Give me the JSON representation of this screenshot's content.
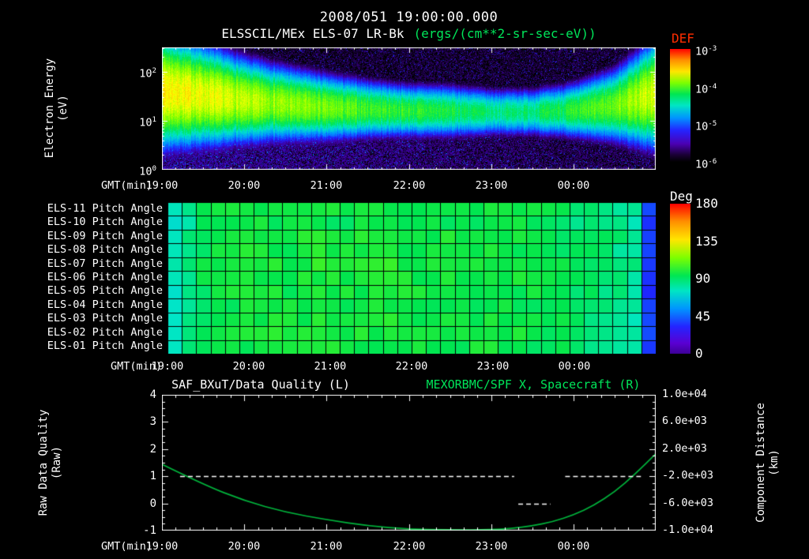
{
  "header": {
    "timestamp": "2008/051 19:00:00.000",
    "instrument": "ELSSCIL/MEx ELS-07 LR-Bk",
    "units": "(ergs/(cm**2-sr-sec-eV))"
  },
  "colors": {
    "background": "#000000",
    "text": "#ffffff",
    "accent_green": "#00e65a",
    "curve_green": "#00b43c",
    "def_red": "#ff2d00"
  },
  "time_axis": {
    "label": "GMT(min)",
    "ticks": [
      "19:00",
      "20:00",
      "21:00",
      "22:00",
      "23:00",
      "00:00"
    ]
  },
  "spectrogram": {
    "ylabel_line1": "Electron Energy",
    "ylabel_line2": "(eV)",
    "yticks": [
      {
        "base": "10",
        "exp": "2"
      },
      {
        "base": "10",
        "exp": "1"
      },
      {
        "base": "10",
        "exp": "0"
      }
    ],
    "colorbar": {
      "label": "DEF",
      "ticks": [
        {
          "base": "10",
          "exp": "-3"
        },
        {
          "base": "10",
          "exp": "-4"
        },
        {
          "base": "10",
          "exp": "-5"
        },
        {
          "base": "10",
          "exp": "-6"
        }
      ]
    }
  },
  "pitch": {
    "row_labels": [
      "ELS-11 Pitch Angle",
      "ELS-10 Pitch Angle",
      "ELS-09 Pitch Angle",
      "ELS-08 Pitch Angle",
      "ELS-07 Pitch Angle",
      "ELS-06 Pitch Angle",
      "ELS-05 Pitch Angle",
      "ELS-04 Pitch Angle",
      "ELS-03 Pitch Angle",
      "ELS-02 Pitch Angle",
      "ELS-01 Pitch Angle"
    ],
    "colorbar": {
      "label": "Deg",
      "ticks": [
        "180",
        "135",
        "90",
        "45",
        "0"
      ]
    }
  },
  "bottom": {
    "title_left": "SAF_BXuT/Data Quality (L)",
    "title_right": "MEXORBMC/SPF X, Spacecraft (R)",
    "ylabel_left_line1": "Raw Data Quality",
    "ylabel_left_line2": "(Raw)",
    "ylabel_right_line1": "Component Distance",
    "ylabel_right_line2": "(km)",
    "left_ticks": [
      "4",
      "3",
      "2",
      "1",
      "0",
      "-1"
    ],
    "right_ticks": [
      "1.0e+04",
      "6.0e+03",
      "2.0e+03",
      "-2.0e+03",
      "-6.0e+03",
      "-1.0e+04"
    ]
  },
  "chart_data": [
    {
      "type": "heatmap",
      "name": "electron-energy-spectrogram",
      "title": "ELSSCIL/MEx ELS-07 LR-Bk",
      "units": "ergs/(cm**2-sr-sec-eV)",
      "x_range_hours": [
        19,
        25
      ],
      "x_tick_labels": [
        "19:00",
        "20:00",
        "21:00",
        "22:00",
        "23:00",
        "00:00"
      ],
      "y_log10_eV_range": [
        0,
        2.5
      ],
      "def_log10_range": [
        -6,
        -3
      ],
      "band_hours": [
        19,
        19.5,
        20,
        20.5,
        21,
        21.5,
        22,
        22.5,
        23,
        23.5,
        24,
        24.5,
        25
      ],
      "band_center_log10_eV": [
        1.6,
        1.52,
        1.42,
        1.35,
        1.28,
        1.24,
        1.21,
        1.2,
        1.18,
        1.18,
        1.22,
        1.32,
        1.55
      ],
      "band_halfwidth_log10": [
        0.45,
        0.4,
        0.34,
        0.3,
        0.27,
        0.24,
        0.22,
        0.22,
        0.2,
        0.2,
        0.23,
        0.3,
        0.44
      ],
      "band_peak_def": [
        0.00025,
        0.0002,
        0.00015,
        0.00012,
        0.0001,
        8e-05,
        7e-05,
        6e-05,
        4.5e-05,
        5e-05,
        6.5e-05,
        0.0001,
        0.00018
      ],
      "background_def": 1e-06,
      "seed": 7
    },
    {
      "type": "heatmap",
      "name": "pitch-angle-panel",
      "rows": [
        "ELS-11",
        "ELS-10",
        "ELS-09",
        "ELS-08",
        "ELS-07",
        "ELS-06",
        "ELS-05",
        "ELS-04",
        "ELS-03",
        "ELS-02",
        "ELS-01"
      ],
      "deg_range": [
        0,
        180
      ],
      "n_time_cols": 34,
      "column_mean_deg": [
        78,
        85,
        93,
        96,
        95,
        96,
        97,
        96,
        95,
        96,
        97,
        96,
        95,
        96,
        96,
        97,
        96,
        95,
        96,
        96,
        95,
        96,
        97,
        96,
        95,
        94,
        93,
        92,
        90,
        89,
        88,
        86,
        82,
        36
      ],
      "row_offset_deg": [
        0,
        -2,
        1,
        0,
        2,
        1,
        0,
        -1,
        0,
        1,
        0
      ],
      "cell_noise_deg": 4,
      "seed": 11
    },
    {
      "type": "line",
      "name": "quality-and-spacecraft-x",
      "x_range_hours": [
        19,
        25
      ],
      "left_axis": {
        "label": "Raw Data Quality (Raw)",
        "range": [
          -1,
          4
        ]
      },
      "right_axis": {
        "label": "Component Distance (km)",
        "range": [
          -10000,
          10000
        ]
      },
      "series": [
        {
          "name": "SAF_BXuT/Data Quality",
          "axis": "left",
          "style": "dashed",
          "color": "#ffffff",
          "segments": [
            {
              "value": 1,
              "from_hour": 19.22,
              "to_hour": 23.28
            },
            {
              "value": 0,
              "from_hour": 23.33,
              "to_hour": 23.72
            },
            {
              "value": 1,
              "from_hour": 23.9,
              "to_hour": 24.82
            }
          ]
        },
        {
          "name": "MEXORBMC/SPF X, Spacecraft",
          "axis": "right",
          "style": "solid",
          "color": "#00b43c",
          "points_hour_km": [
            [
              19.0,
              -230
            ],
            [
              19.5,
              -3200
            ],
            [
              20.0,
              -5600
            ],
            [
              20.5,
              -7300
            ],
            [
              21.0,
              -8400
            ],
            [
              21.5,
              -9300
            ],
            [
              22.0,
              -9800
            ],
            [
              22.5,
              -10000
            ],
            [
              23.0,
              -9950
            ],
            [
              23.25,
              -9700
            ],
            [
              23.5,
              -9300
            ],
            [
              23.75,
              -8700
            ],
            [
              24.0,
              -7700
            ],
            [
              24.25,
              -6300
            ],
            [
              24.5,
              -4300
            ],
            [
              24.75,
              -1700
            ],
            [
              25.0,
              1300
            ]
          ]
        }
      ]
    }
  ]
}
